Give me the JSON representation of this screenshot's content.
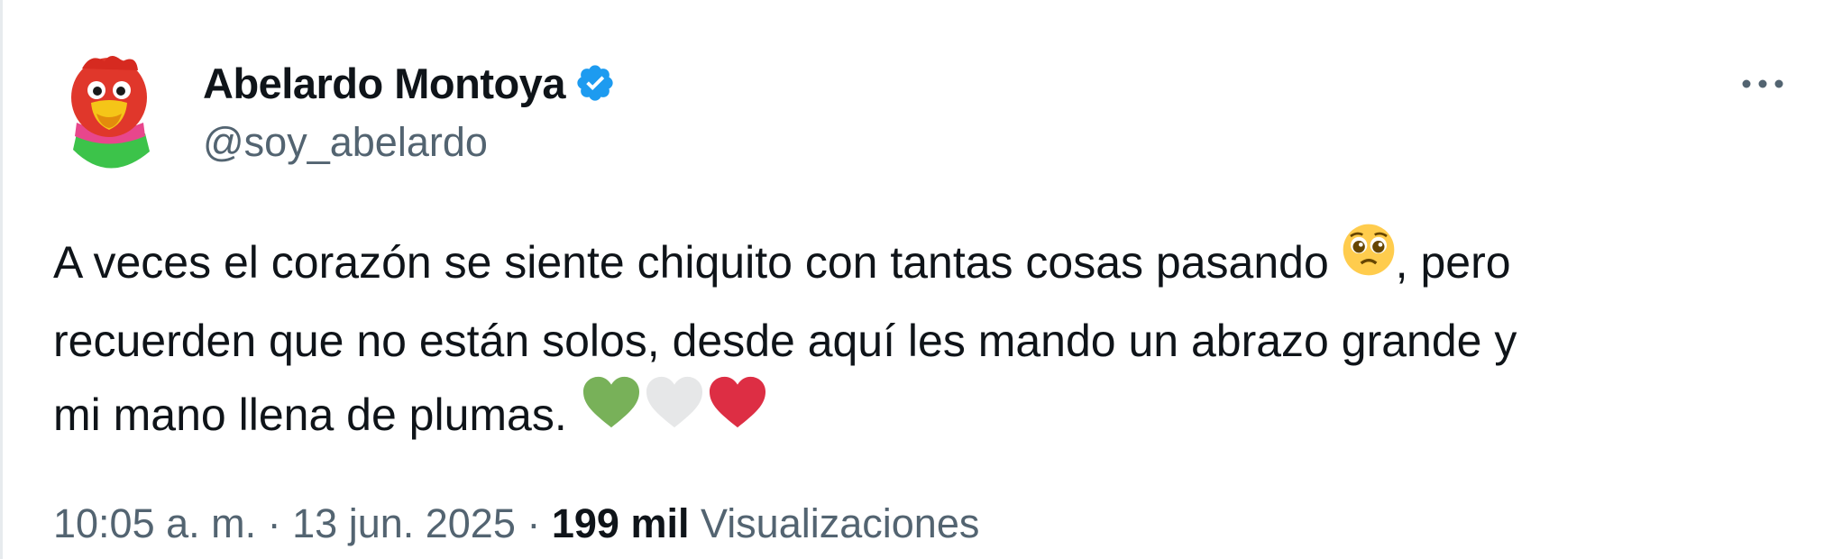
{
  "tweet": {
    "author": {
      "display_name": "Abelardo Montoya",
      "handle": "@soy_abelardo",
      "verified": true,
      "avatar_icon": "parrot-mascot-avatar"
    },
    "more_icon": "ellipsis-icon",
    "text": {
      "line1_before": "A veces el corazón se siente chiquito con tantas cosas pasando ",
      "line1_emoji": "pleading-face-emoji",
      "line1_after": ", pero",
      "line2": "recuerden que no están solos, desde aquí les mando un abrazo grande y",
      "line3": "mi mano llena de plumas. ",
      "hearts": [
        "green-heart-emoji",
        "white-heart-emoji",
        "red-heart-emoji"
      ]
    },
    "meta": {
      "time": "10:05 a. m.",
      "sep1": " · ",
      "date": "13 jun. 2025",
      "sep2": " · ",
      "views_count": "199 mil",
      "views_label": " Visualizaciones"
    },
    "colors": {
      "text": "#0f1419",
      "secondary": "#536471",
      "verified": "#1d9bf0",
      "heart_green": "#78b159",
      "heart_white": "#e6e7e8",
      "heart_red": "#dd2e44"
    }
  }
}
